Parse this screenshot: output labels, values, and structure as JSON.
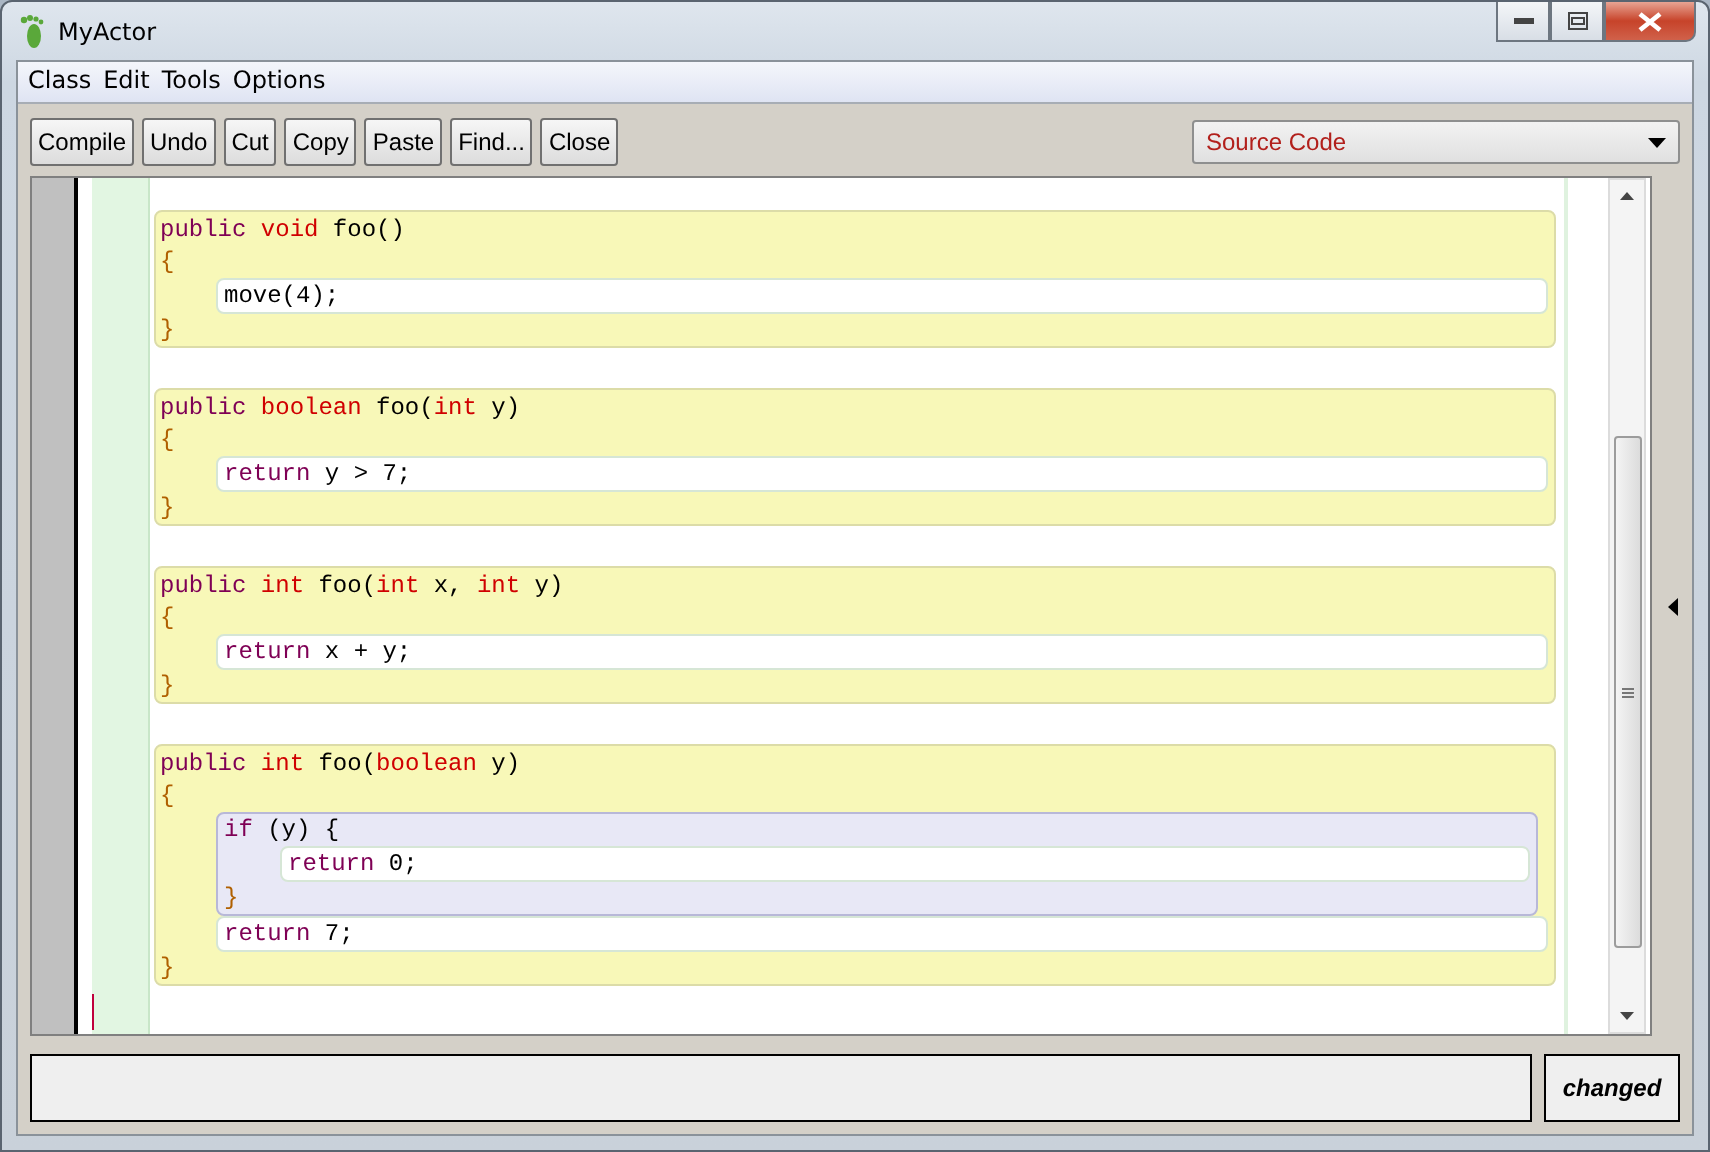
{
  "window": {
    "title": "MyActor"
  },
  "menu": [
    "Class",
    "Edit",
    "Tools",
    "Options"
  ],
  "toolbar": [
    "Compile",
    "Undo",
    "Cut",
    "Copy",
    "Paste",
    "Find...",
    "Close"
  ],
  "view_select": {
    "value": "Source Code"
  },
  "methods": [
    {
      "header": [
        {
          "kind": "keyword",
          "text": "public"
        },
        {
          "kind": "type",
          "text": " void"
        },
        {
          "kind": "plain",
          "text": " foo()"
        }
      ],
      "open": "{",
      "close": "}",
      "body": [
        {
          "kind": "statement",
          "tokens": [
            {
              "kind": "plain",
              "text": "move(4);"
            }
          ]
        }
      ]
    },
    {
      "header": [
        {
          "kind": "keyword",
          "text": "public"
        },
        {
          "kind": "type",
          "text": " boolean"
        },
        {
          "kind": "plain",
          "text": " foo("
        },
        {
          "kind": "type",
          "text": "int"
        },
        {
          "kind": "plain",
          "text": " y)"
        }
      ],
      "open": "{",
      "close": "}",
      "body": [
        {
          "kind": "statement",
          "tokens": [
            {
              "kind": "keyword",
              "text": "return"
            },
            {
              "kind": "plain",
              "text": " y > 7;"
            }
          ]
        }
      ]
    },
    {
      "header": [
        {
          "kind": "keyword",
          "text": "public"
        },
        {
          "kind": "type",
          "text": " int"
        },
        {
          "kind": "plain",
          "text": " foo("
        },
        {
          "kind": "type",
          "text": "int"
        },
        {
          "kind": "plain",
          "text": " x, "
        },
        {
          "kind": "type",
          "text": "int"
        },
        {
          "kind": "plain",
          "text": " y)"
        }
      ],
      "open": "{",
      "close": "}",
      "body": [
        {
          "kind": "statement",
          "tokens": [
            {
              "kind": "keyword",
              "text": "return"
            },
            {
              "kind": "plain",
              "text": " x + y;"
            }
          ]
        }
      ]
    },
    {
      "header": [
        {
          "kind": "keyword",
          "text": "public"
        },
        {
          "kind": "type",
          "text": " int"
        },
        {
          "kind": "plain",
          "text": " foo("
        },
        {
          "kind": "type",
          "text": "boolean"
        },
        {
          "kind": "plain",
          "text": " y)"
        }
      ],
      "open": "{",
      "close": "}",
      "body": [
        {
          "kind": "block",
          "header": [
            {
              "kind": "keyword",
              "text": "if"
            },
            {
              "kind": "plain",
              "text": " (y) {"
            }
          ],
          "close": "}",
          "body": [
            {
              "kind": "statement",
              "tokens": [
                {
                  "kind": "keyword",
                  "text": "return"
                },
                {
                  "kind": "plain",
                  "text": " 0;"
                }
              ]
            }
          ]
        },
        {
          "kind": "statement",
          "tokens": [
            {
              "kind": "keyword",
              "text": "return"
            },
            {
              "kind": "plain",
              "text": " 7;"
            }
          ]
        }
      ]
    }
  ],
  "status": {
    "state": "changed"
  }
}
